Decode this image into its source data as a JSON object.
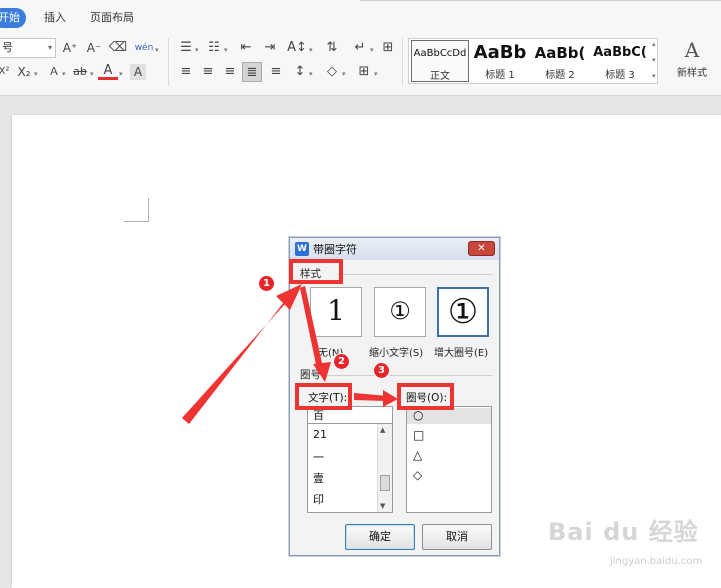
{
  "ribbon": {
    "tabs": [
      "开始",
      "插入",
      "页面布局"
    ],
    "active_tab": "开始",
    "font_size_value": "号",
    "styles": [
      {
        "sample": "AaBbCcDd",
        "name": "正文"
      },
      {
        "sample": "AaBb",
        "name": "标题 1"
      },
      {
        "sample": "AaBb(",
        "name": "标题 2"
      },
      {
        "sample": "AaBbC(",
        "name": "标题 3"
      }
    ],
    "new_style_glyph": "A",
    "new_style_label": "新样式"
  },
  "icons": {
    "grow_font": "A⁺",
    "shrink_font": "A⁻",
    "clear_format": "⌫",
    "phonetic": "wén",
    "superscript": "X²",
    "subscript": "X₂",
    "strike": "ab",
    "font_color": "A",
    "char_shading": "A"
  },
  "dialog": {
    "title": "带圈字符",
    "app_icon": "W",
    "close_symbol": "✕",
    "style_group_label": "样式",
    "style_options": [
      {
        "glyph": "1",
        "label": "无(N)"
      },
      {
        "glyph": "①",
        "label": "缩小文字(S)"
      },
      {
        "glyph": "①",
        "label": "增大圈号(E)"
      }
    ],
    "circle_group_label": "圈号",
    "text_label": "文字(T):",
    "circle_label": "圈号(O):",
    "text_list": [
      "百",
      "21",
      "一",
      "壹",
      "印"
    ],
    "circle_list": [
      "○",
      "□",
      "△",
      "◇"
    ],
    "ok_label": "确定",
    "cancel_label": "取消"
  },
  "callouts": {
    "badges": [
      "1",
      "2",
      "3"
    ]
  },
  "watermark": {
    "main": "Bai du 经验",
    "sub": "jingyan.baidu.com"
  },
  "colors": {
    "accent": "#3b7ddd",
    "callout_red": "#ee3333"
  }
}
